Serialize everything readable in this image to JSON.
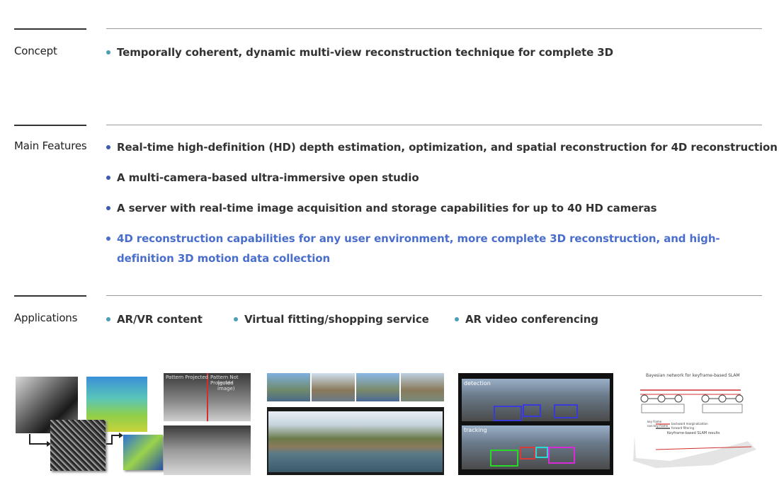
{
  "concept": {
    "label": "Concept",
    "items": [
      "Temporally coherent, dynamic multi-view reconstruction technique for complete 3D"
    ]
  },
  "main_features": {
    "label": "Main Features",
    "items": [
      "Real-time high-definition (HD) depth estimation, optimization, and spatial reconstruction for 4D reconstruction",
      "A multi-camera-based ultra-immersive open studio",
      "A server with real-time image acquisition and storage capabilities for up to 40 HD cameras"
    ],
    "highlight": "4D reconstruction capabilities for any user environment, more complete 3D reconstruction, and high-definition 3D motion data collection"
  },
  "applications": {
    "label": "Applications",
    "items": [
      "AR/VR content",
      "Virtual fitting/shopping service",
      "AR video conferencing"
    ]
  },
  "figures": {
    "pattern_projected": "Pattern Projected",
    "pattern_not_projected": "Pattern Not Projected",
    "guide_image": "(guide image)",
    "detection": "detection",
    "tracking": "tracking",
    "slam_title": "Bayesian network for keyframe-based SLAM",
    "slam_results": "Keyframe-based SLAM results",
    "slam_legend_key": "key frame",
    "slam_legend_nonkey": "non-key frame",
    "slam_legend_backward": "backward marginalization",
    "slam_legend_forward": "forward filtering"
  },
  "colors": {
    "bullet": "#4a9fb4",
    "highlight": "#4a6ecc",
    "text": "#333333"
  }
}
